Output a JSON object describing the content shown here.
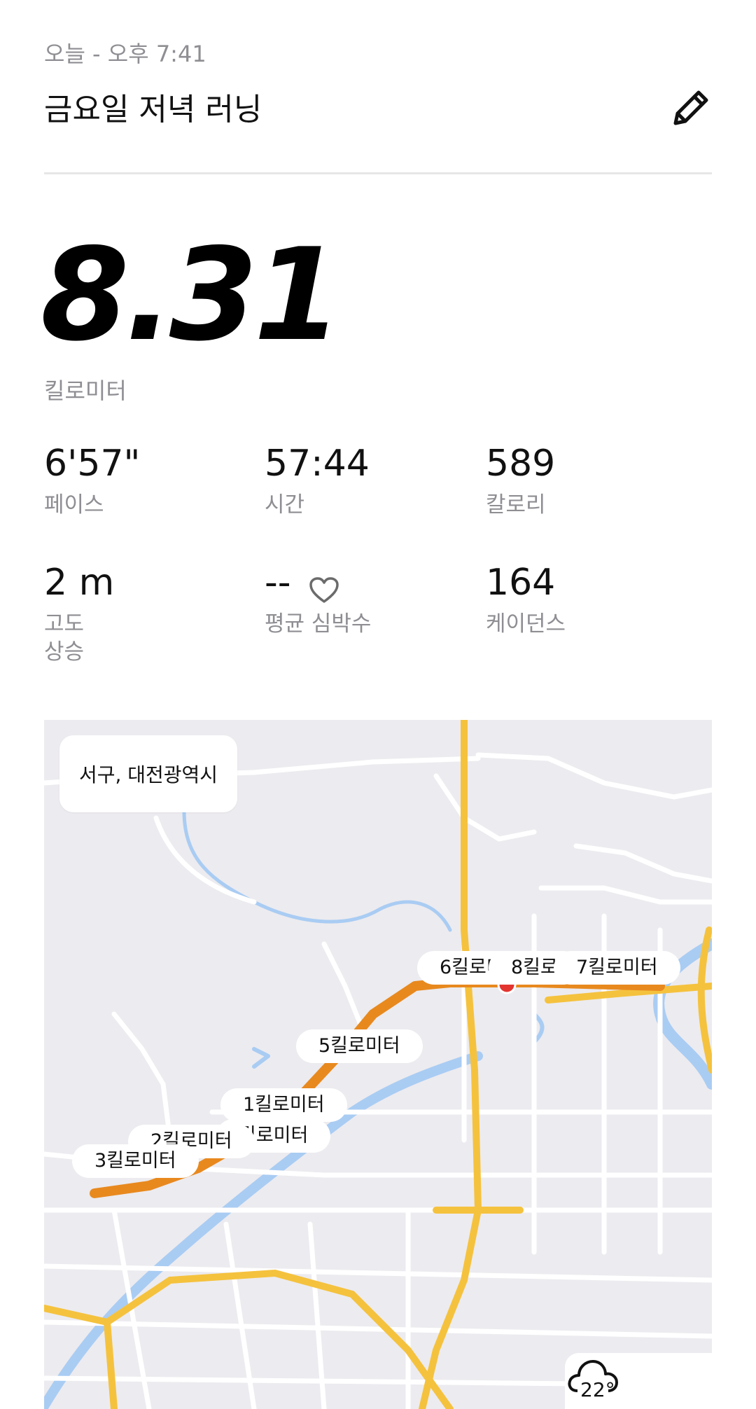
{
  "header": {
    "date": "오늘 - 오후 7:41",
    "title": "금요일 저녁 러닝"
  },
  "summary": {
    "distance": "8.31",
    "unit": "킬로미터"
  },
  "stats": [
    {
      "value": "6'57\"",
      "label": "페이스"
    },
    {
      "value": "57:44",
      "label": "시간"
    },
    {
      "value": "589",
      "label": "칼로리"
    },
    {
      "value": "2 m",
      "label_line1": "고도",
      "label_line2": "상승"
    },
    {
      "value": "--",
      "label": "평균 심박수"
    },
    {
      "value": "164",
      "label": "케이던스"
    }
  ],
  "map": {
    "location": "서구, 대전광역시",
    "markers": [
      {
        "label": "6킬로미"
      },
      {
        "label": "8킬로"
      },
      {
        "label": "7킬로미터"
      },
      {
        "label": "5킬로미터"
      },
      {
        "label": "1킬로미터"
      },
      {
        "label": "킬로미터"
      },
      {
        "label": "2킬로미터"
      },
      {
        "label": "3킬로미터"
      }
    ],
    "weather_temp": "22°",
    "route_color": "#e8891e"
  },
  "icons": {
    "edit": "pencil-icon",
    "heart": "heart-icon",
    "weather": "cloud-icon"
  }
}
